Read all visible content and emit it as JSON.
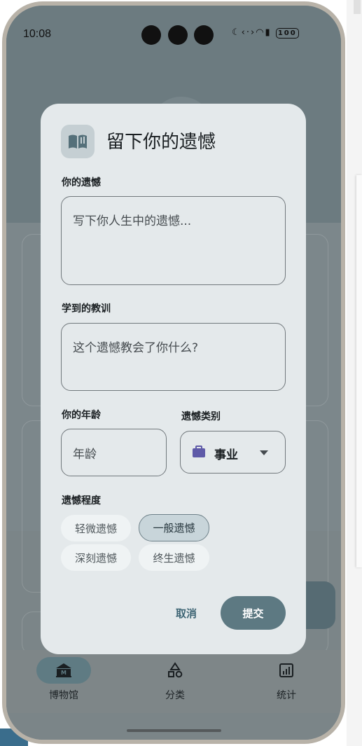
{
  "status_bar": {
    "time": "10:08",
    "battery": "100"
  },
  "dialog": {
    "title": "留下你的遗憾",
    "regret_label": "你的遗憾",
    "regret_placeholder": "写下你人生中的遗憾...",
    "lesson_label": "学到的教训",
    "lesson_placeholder": "这个遗憾教会了你什么?",
    "age_label": "你的年龄",
    "age_placeholder": "年龄",
    "category_label": "遗憾类别",
    "category_value": "事业",
    "degree_label": "遗憾程度",
    "degree_options": [
      "轻微遗憾",
      "一般遗憾",
      "深刻遗憾",
      "终生遗憾"
    ],
    "degree_selected": "一般遗憾",
    "cancel": "取消",
    "submit": "提交"
  },
  "bottom_nav": [
    {
      "label": "博物馆",
      "icon": "museum-icon",
      "active": true
    },
    {
      "label": "分类",
      "icon": "category-icon",
      "active": false
    },
    {
      "label": "统计",
      "icon": "stats-icon",
      "active": false
    }
  ],
  "colors": {
    "accent": "#5d7982",
    "dialog_bg": "#e4e9eb",
    "chip_selected": "#c8d5da",
    "briefcase": "#5e5aa8"
  }
}
